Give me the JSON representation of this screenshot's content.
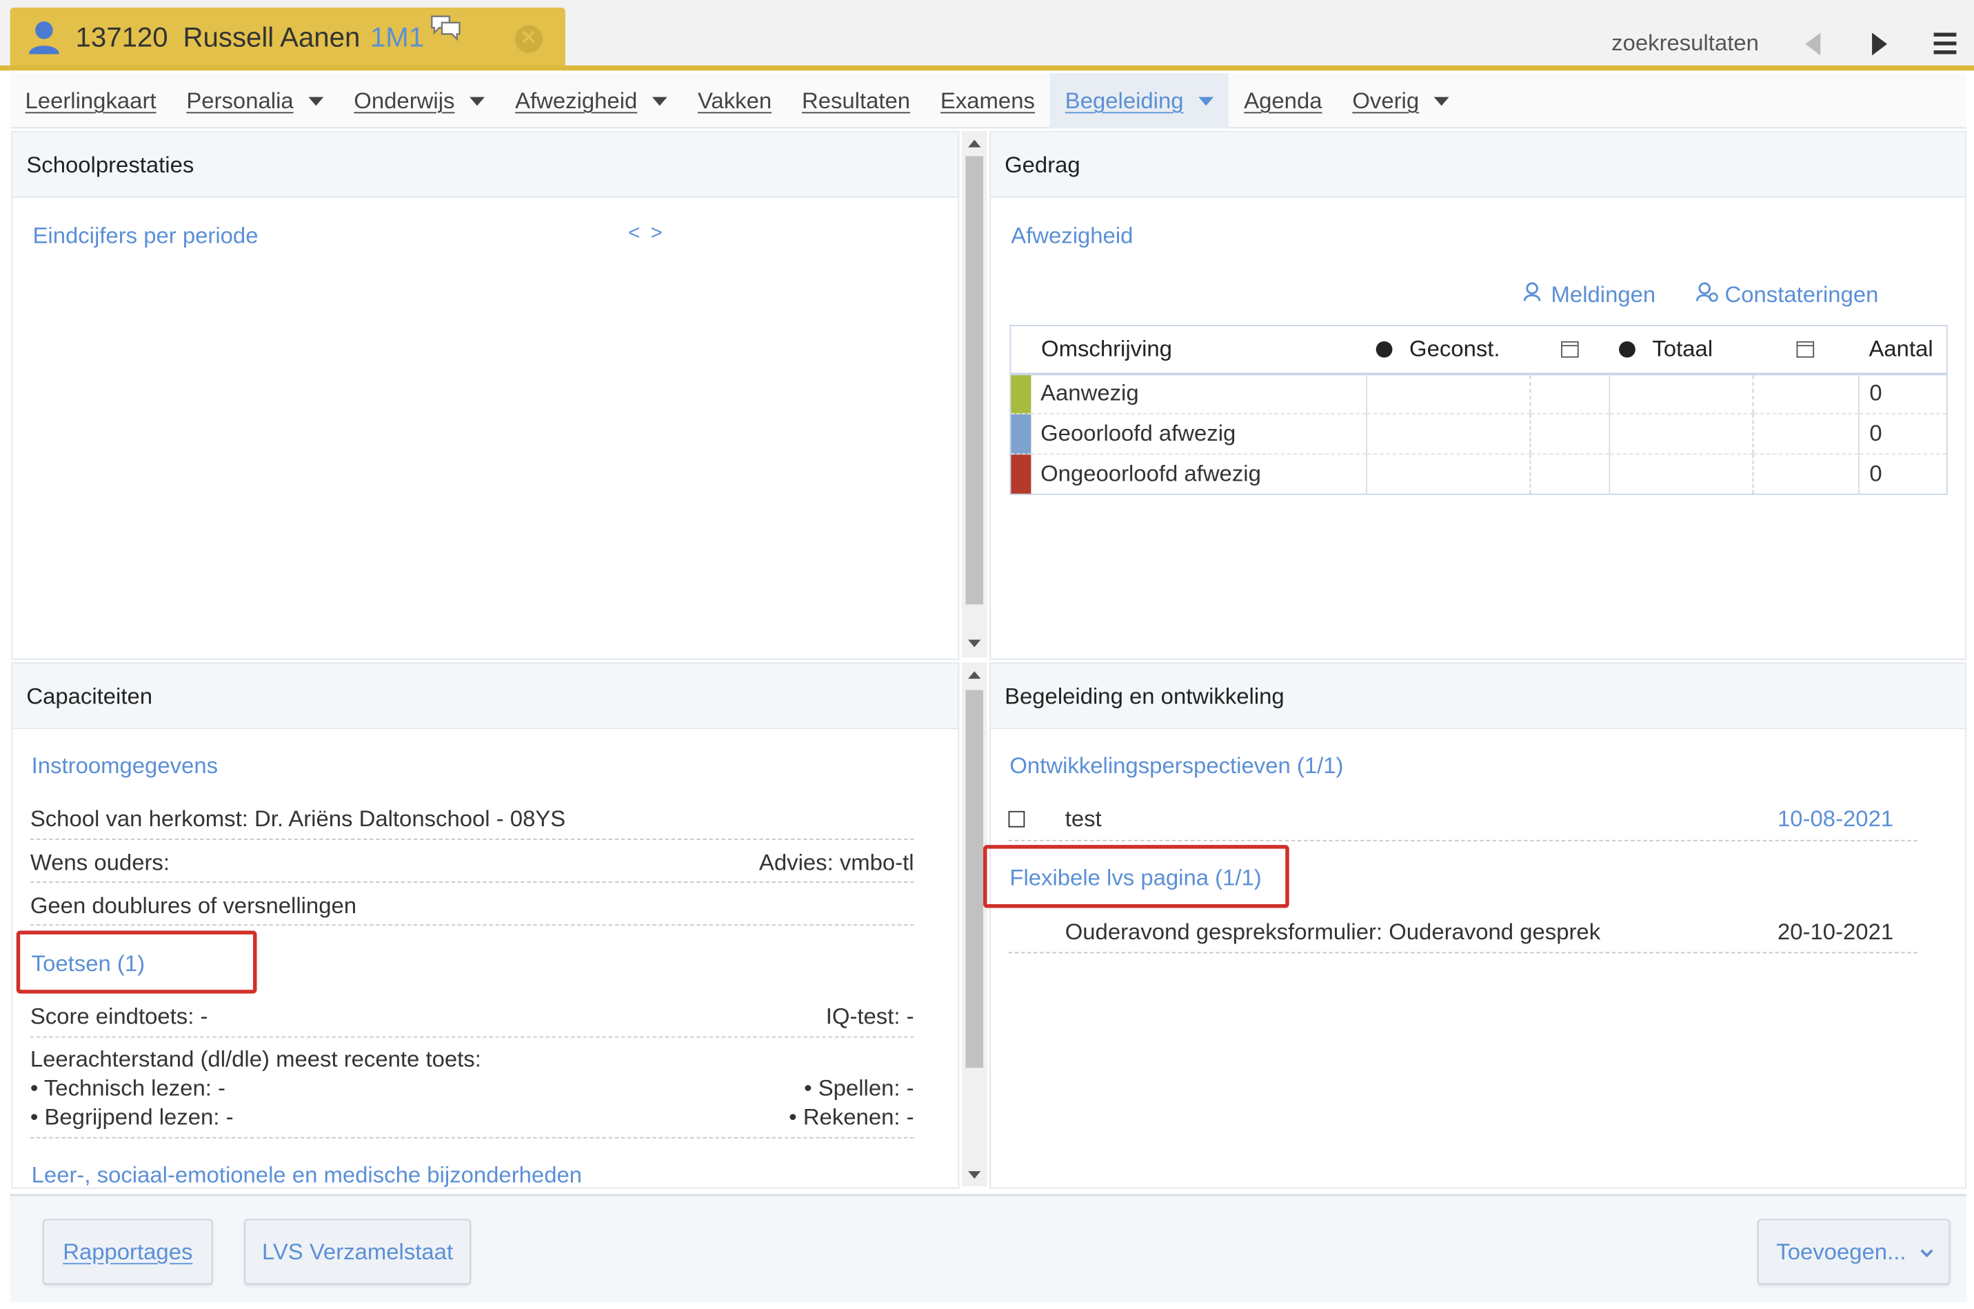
{
  "student": {
    "number": "137120",
    "name": "Russell Aanen",
    "class": "1M1"
  },
  "topbar": {
    "search_results": "zoekresultaten"
  },
  "nav": [
    {
      "label": "Leerlingkaart",
      "dropdown": false,
      "active": false
    },
    {
      "label": "Personalia",
      "dropdown": true,
      "active": false
    },
    {
      "label": "Onderwijs",
      "dropdown": true,
      "active": false
    },
    {
      "label": "Afwezigheid",
      "dropdown": true,
      "active": false
    },
    {
      "label": "Vakken",
      "dropdown": false,
      "active": false
    },
    {
      "label": "Resultaten",
      "dropdown": false,
      "active": false
    },
    {
      "label": "Examens",
      "dropdown": false,
      "active": false
    },
    {
      "label": "Begeleiding",
      "dropdown": true,
      "active": true
    },
    {
      "label": "Agenda",
      "dropdown": false,
      "active": false
    },
    {
      "label": "Overig",
      "dropdown": true,
      "active": false
    }
  ],
  "schoolprestaties": {
    "title": "Schoolprestaties",
    "link": "Eindcijfers per periode",
    "nav_arrows": "< >"
  },
  "gedrag": {
    "title": "Gedrag",
    "link": "Afwezigheid",
    "meldingen": "Meldingen",
    "constateringen": "Constateringen",
    "columns": {
      "omschrijving": "Omschrijving",
      "geconst": "Geconst.",
      "totaal": "Totaal",
      "aantal": "Aantal"
    },
    "rows": [
      {
        "color": "#a9bb3f",
        "label": "Aanwezig",
        "aantal": "0"
      },
      {
        "color": "#7ea3cf",
        "label": "Geoorloofd afwezig",
        "aantal": "0"
      },
      {
        "color": "#b53a2b",
        "label": "Ongeoorloofd afwezig",
        "aantal": "0"
      }
    ]
  },
  "capaciteiten": {
    "title": "Capaciteiten",
    "instroom_link": "Instroomgegevens",
    "school_herkomst": "School van herkomst: Dr. Ariëns Daltonschool - 08YS",
    "wens_ouders": "Wens ouders:",
    "advies": "Advies: vmbo-tl",
    "doublures": "Geen doublures of versnellingen",
    "toetsen_link": "Toetsen (1)",
    "score_eindtoets": "Score eindtoets: -",
    "iq_test": "IQ-test: -",
    "leerachterstand": "Leerachterstand (dl/dle) meest recente toets:",
    "technisch_lezen": "• Technisch lezen: -",
    "spellen": "• Spellen: -",
    "begrijpend_lezen": "• Begrijpend lezen: -",
    "rekenen": "• Rekenen: -",
    "bijzonderheden_link": "Leer-, sociaal-emotionele en medische bijzonderheden"
  },
  "begeleiding": {
    "title": "Begeleiding en ontwikkeling",
    "opp_link": "Ontwikkelingsperspectieven (1/1)",
    "opp_item": "test",
    "opp_date": "10-08-2021",
    "flex_link": "Flexibele lvs pagina (1/1)",
    "flex_item": "Ouderavond gespreksformulier: Ouderavond gesprek",
    "flex_date": "20-10-2021"
  },
  "bottom": {
    "rapportages": "Rapportages",
    "lvs": "LVS Verzamelstaat",
    "toevoegen": "Toevoegen..."
  },
  "colors": {
    "accent": "#5b8fd6",
    "tab": "#e3c04a",
    "highlight": "#d0302a"
  }
}
